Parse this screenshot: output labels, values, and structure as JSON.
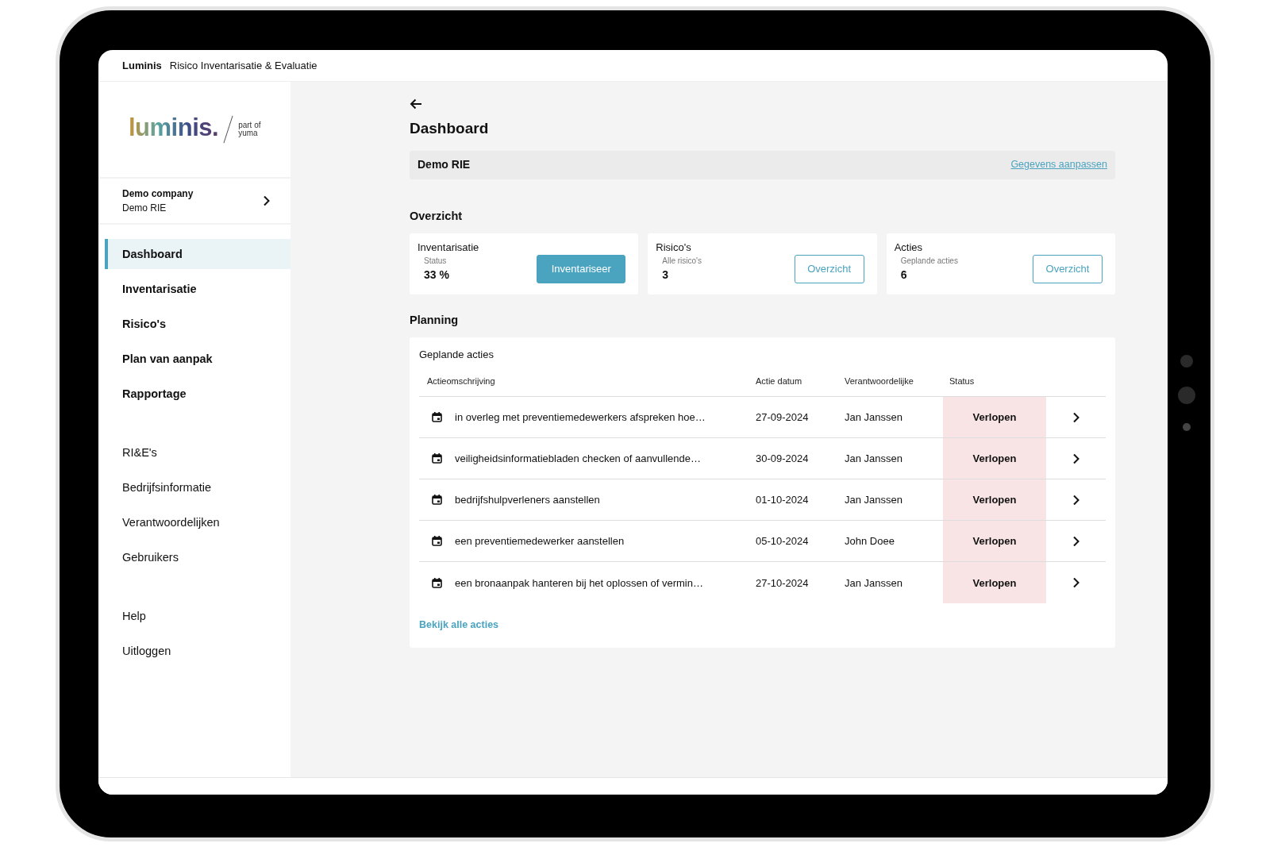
{
  "app_bar": {
    "brand": "Luminis",
    "title": "Risico Inventarisatie & Evaluatie"
  },
  "sidebar": {
    "logo": {
      "wordmark": "luminis.",
      "tagline": [
        "part of",
        "yuma"
      ]
    },
    "company": {
      "name": "Demo company",
      "project": "Demo RIE"
    },
    "nav_groups": [
      [
        {
          "label": "Dashboard",
          "kind": "main",
          "selected": true
        },
        {
          "label": "Inventarisatie",
          "kind": "main",
          "selected": false
        },
        {
          "label": "Risico's",
          "kind": "main",
          "selected": false
        },
        {
          "label": "Plan van aanpak",
          "kind": "main",
          "selected": false
        },
        {
          "label": "Rapportage",
          "kind": "main",
          "selected": false
        }
      ],
      [
        {
          "label": "RI&E's",
          "kind": "secondary",
          "selected": false
        },
        {
          "label": "Bedrijfsinformatie",
          "kind": "secondary",
          "selected": false
        },
        {
          "label": "Verantwoordelijken",
          "kind": "secondary",
          "selected": false
        },
        {
          "label": "Gebruikers",
          "kind": "secondary",
          "selected": false
        }
      ],
      [
        {
          "label": "Help",
          "kind": "secondary",
          "selected": false
        },
        {
          "label": "Uitloggen",
          "kind": "secondary",
          "selected": false
        }
      ]
    ]
  },
  "main": {
    "title": "Dashboard",
    "project_bar": {
      "name": "Demo RIE",
      "link": "Gegevens aanpassen"
    },
    "overview": {
      "heading": "Overzicht",
      "cards": [
        {
          "title": "Inventarisatie",
          "label": "Status",
          "value": "33 %",
          "button": {
            "label": "Inventariseer",
            "kind": "primary"
          }
        },
        {
          "title": "Risico's",
          "label": "Alle risico's",
          "value": "3",
          "button": {
            "label": "Overzicht",
            "kind": "outline"
          }
        },
        {
          "title": "Acties",
          "label": "Geplande acties",
          "value": "6",
          "button": {
            "label": "Overzicht",
            "kind": "outline"
          }
        }
      ]
    },
    "planning": {
      "heading": "Planning",
      "card_title": "Geplande acties",
      "columns": [
        "Actieomschrijving",
        "Actie datum",
        "Verantwoordelijke",
        "Status"
      ],
      "rows": [
        {
          "description": "in overleg met preventiemedewerkers afspreken hoe…",
          "date": "27-09-2024",
          "responsible": "Jan Janssen",
          "status": "Verlopen",
          "overdue": true
        },
        {
          "description": "veiligheidsinformatiebladen checken of aanvullende…",
          "date": "30-09-2024",
          "responsible": "Jan Janssen",
          "status": "Verlopen",
          "overdue": true
        },
        {
          "description": "bedrijfshulpverleners aanstellen",
          "date": "01-10-2024",
          "responsible": "Jan Janssen",
          "status": "Verlopen",
          "overdue": true
        },
        {
          "description": "een preventiemedewerker aanstellen",
          "date": "05-10-2024",
          "responsible": "John Doee",
          "status": "Verlopen",
          "overdue": true
        },
        {
          "description": "een bronaanpak hanteren bij het oplossen of vermin…",
          "date": "27-10-2024",
          "responsible": "Jan Janssen",
          "status": "Verlopen",
          "overdue": true
        }
      ],
      "link": "Bekijk alle acties"
    }
  }
}
